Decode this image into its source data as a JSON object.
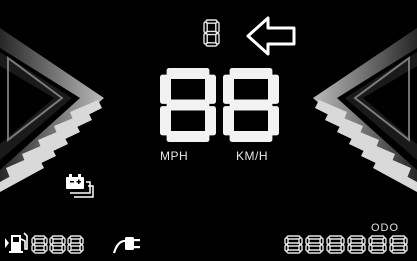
{
  "speed": {
    "digits": "88",
    "unit_mph": "MPH",
    "unit_kmh": "KM/H"
  },
  "gear": {
    "digit": "8",
    "indicator_icon": "left-arrow-icon"
  },
  "battery": {
    "icon": "battery-icon"
  },
  "fuel": {
    "icon": "fuel-pump-icon",
    "digits": "888"
  },
  "charge": {
    "icon": "charging-plug-icon"
  },
  "odometer": {
    "label": "ODO",
    "digits": "888888"
  },
  "colors": {
    "background": "#000000",
    "segment": "#f2f2f2",
    "chevron": "#cfcfcf"
  }
}
